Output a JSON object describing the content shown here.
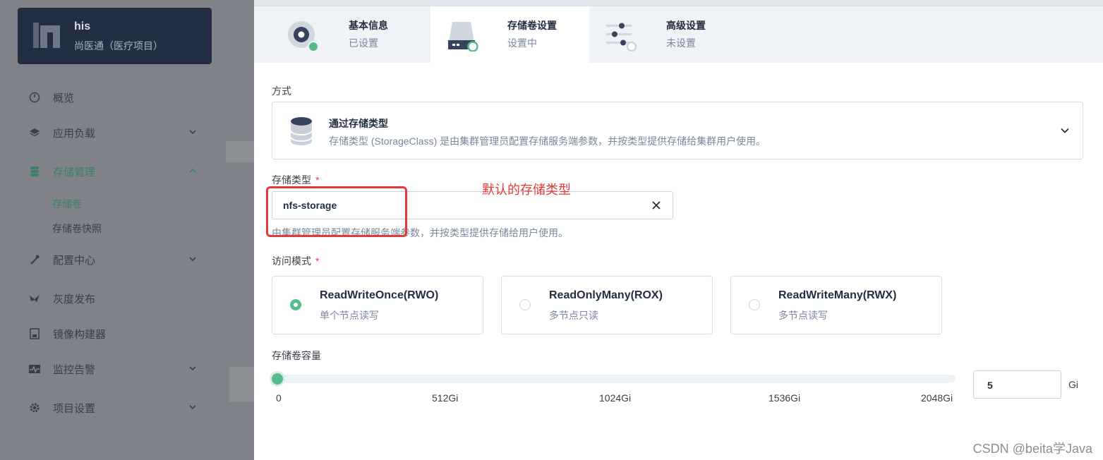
{
  "project": {
    "name": "his",
    "subtitle": "尚医通（医疗项目）"
  },
  "sidebar": {
    "items": [
      {
        "label": "概览"
      },
      {
        "label": "应用负载"
      },
      {
        "label": "存储管理"
      },
      {
        "label": "配置中心"
      },
      {
        "label": "灰度发布"
      },
      {
        "label": "镜像构建器"
      },
      {
        "label": "监控告警"
      },
      {
        "label": "项目设置"
      }
    ],
    "storage_sub": [
      {
        "label": "存储卷"
      },
      {
        "label": "存储卷快照"
      }
    ]
  },
  "steps": [
    {
      "title": "基本信息",
      "status": "已设置"
    },
    {
      "title": "存储卷设置",
      "status": "设置中"
    },
    {
      "title": "高级设置",
      "status": "未设置"
    }
  ],
  "method": {
    "label": "方式",
    "title": "通过存储类型",
    "description": "存储类型 (StorageClass) 是由集群管理员配置存储服务端参数，并按类型提供存储给集群用户使用。"
  },
  "storage_class": {
    "label": "存储类型",
    "required_mark": "*",
    "value": "nfs-storage",
    "description": "由集群管理员配置存储服务端参数，并按类型提供存储给用户使用。"
  },
  "annotation": "默认的存储类型",
  "access_mode": {
    "label": "访问模式",
    "required_mark": "*",
    "options": [
      {
        "title": "ReadWriteOnce(RWO)",
        "desc": "单个节点读写",
        "selected": true
      },
      {
        "title": "ReadOnlyMany(ROX)",
        "desc": "多节点只读",
        "selected": false
      },
      {
        "title": "ReadWriteMany(RWX)",
        "desc": "多节点读写",
        "selected": false
      }
    ]
  },
  "capacity": {
    "label": "存储卷容量",
    "ticks": [
      "0",
      "512Gi",
      "1024Gi",
      "1536Gi",
      "2048Gi"
    ],
    "slider_max": 2048,
    "value": "5",
    "unit": "Gi"
  },
  "watermark": "CSDN @beita学Java",
  "colors": {
    "accent": "#55bc8a",
    "annotation": "#e23a3a",
    "sidebar_active": "#3c7f6e"
  }
}
